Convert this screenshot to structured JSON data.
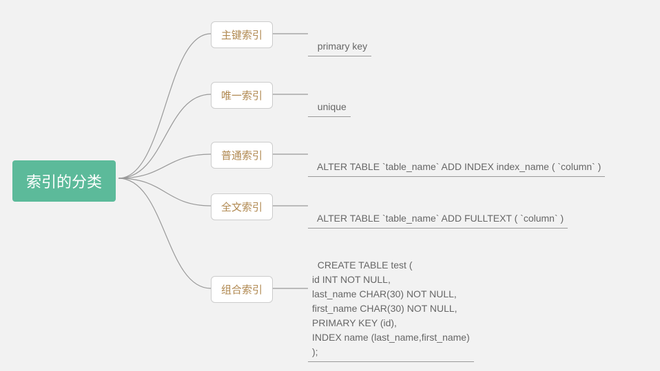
{
  "root": {
    "label": "索引的分类"
  },
  "children": [
    {
      "label": "主键索引",
      "leaf": "primary key"
    },
    {
      "label": "唯一索引",
      "leaf": "unique"
    },
    {
      "label": "普通索引",
      "leaf": "ALTER TABLE `table_name` ADD INDEX index_name ( `column` )"
    },
    {
      "label": "全文索引",
      "leaf": "ALTER TABLE `table_name` ADD FULLTEXT ( `column` )"
    },
    {
      "label": "组合索引",
      "leaf": "CREATE TABLE test (\nid INT NOT NULL,\nlast_name CHAR(30) NOT NULL,\nfirst_name CHAR(30) NOT NULL,\nPRIMARY KEY (id),\nINDEX name (last_name,first_name)\n);"
    }
  ],
  "colors": {
    "root_bg": "#5cba9a",
    "root_fg": "#ffffff",
    "child_border": "#cccccc",
    "child_fg": "#b08850",
    "leaf_fg": "#666666",
    "connector": "#999999",
    "page_bg": "#f2f2f2"
  },
  "chart_data": {
    "type": "mindmap",
    "root": "索引的分类",
    "branches": [
      {
        "name": "主键索引",
        "detail": "primary key"
      },
      {
        "name": "唯一索引",
        "detail": "unique"
      },
      {
        "name": "普通索引",
        "detail": "ALTER TABLE `table_name` ADD INDEX index_name ( `column` )"
      },
      {
        "name": "全文索引",
        "detail": "ALTER TABLE `table_name` ADD FULLTEXT ( `column` )"
      },
      {
        "name": "组合索引",
        "detail": "CREATE TABLE test (\nid INT NOT NULL,\nlast_name CHAR(30) NOT NULL,\nfirst_name CHAR(30) NOT NULL,\nPRIMARY KEY (id),\nINDEX name (last_name,first_name)\n);"
      }
    ]
  }
}
